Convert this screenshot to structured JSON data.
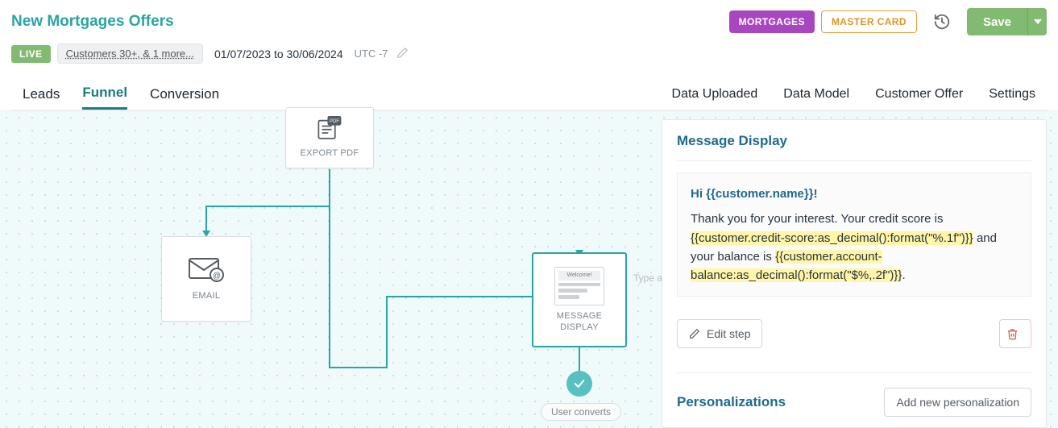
{
  "header": {
    "title": "New Mortgages Offers",
    "tag_mortgages": "MORTGAGES",
    "tag_master": "MASTER CARD",
    "save_label": "Save"
  },
  "subheader": {
    "live_badge": "LIVE",
    "segment_chip": "Customers 30+, & 1 more...",
    "date_from": "01/07/2023",
    "date_to_word": "to",
    "date_to": "30/06/2024",
    "timezone": "UTC -7"
  },
  "tabs_left": [
    "Leads",
    "Funnel",
    "Conversion"
  ],
  "tabs_right": [
    "Data Uploaded",
    "Data Model",
    "Customer Offer",
    "Settings"
  ],
  "active_tab": "Funnel",
  "flow": {
    "node_pdf_label": "EXPORT PDF",
    "node_email_label": "EMAIL",
    "node_msg_label_l1": "MESSAGE",
    "node_msg_label_l2": "DISPLAY",
    "msg_thumb_text": "Welcome!",
    "type_a_placeholder": "Type a",
    "user_converts": "User converts"
  },
  "panel": {
    "title": "Message Display",
    "greeting_prefix": "Hi ",
    "greeting_token": "{{customer.name}}",
    "greeting_suffix": "!",
    "body_pre": "Thank you for your interest. Your credit score is ",
    "token_credit": "{{customer.credit-score:as_decimal():format(\"%.1f\")}}",
    "body_mid": " and your balance is ",
    "token_balance": "{{customer.account-balance:as_decimal():format(\"$%,.2f\")}}",
    "body_post": ".",
    "edit_step": "Edit step",
    "personalizations_title": "Personalizations",
    "add_personalization": "Add new personalization"
  }
}
